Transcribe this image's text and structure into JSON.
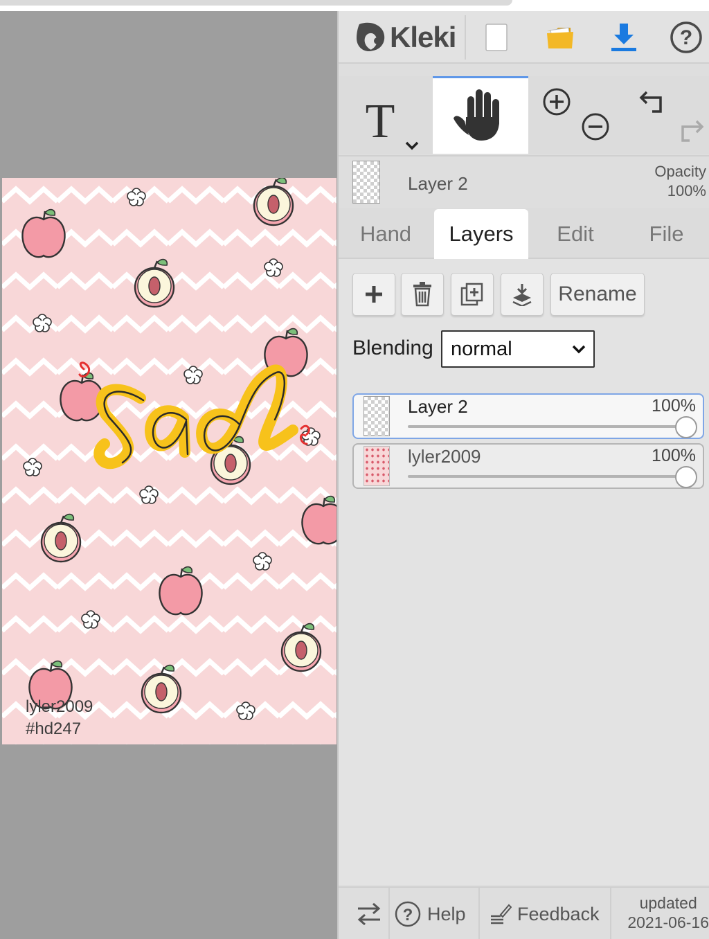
{
  "app": {
    "name": "Kleki"
  },
  "canvas": {
    "signature_line1": "lyler2009",
    "signature_line2": "#hd247",
    "artwork_text": "sad",
    "bg_color": "#f8d7d8"
  },
  "toolbar_icons": [
    "kleki-logo-icon",
    "new-file-icon",
    "open-folder-icon",
    "download-icon",
    "help-icon"
  ],
  "tools_icons": [
    "text-tool-icon",
    "hand-tool-icon",
    "zoom-in-icon",
    "zoom-out-icon",
    "undo-icon",
    "redo-icon"
  ],
  "current_layer": {
    "name": "Layer 2",
    "opacity_label": "Opacity",
    "opacity_value": "100%"
  },
  "tabs": [
    {
      "label": "Hand",
      "active": false
    },
    {
      "label": "Layers",
      "active": true
    },
    {
      "label": "Edit",
      "active": false
    },
    {
      "label": "File",
      "active": false
    }
  ],
  "layer_panel": {
    "rename_label": "Rename",
    "blending_label": "Blending",
    "blending_value": "normal",
    "layers": [
      {
        "name": "Layer 2",
        "opacity": "100%",
        "opacity_fraction": 1.0,
        "selected": true
      },
      {
        "name": "lyler2009",
        "opacity": "100%",
        "opacity_fraction": 1.0,
        "selected": false
      }
    ]
  },
  "bottom": {
    "help_label": "Help",
    "feedback_label": "Feedback",
    "updated_label": "updated",
    "updated_date": "2021-06-16"
  },
  "colors": {
    "accent": "#5f97e8",
    "download": "#1a7ae0",
    "folder": "#f3b826"
  }
}
